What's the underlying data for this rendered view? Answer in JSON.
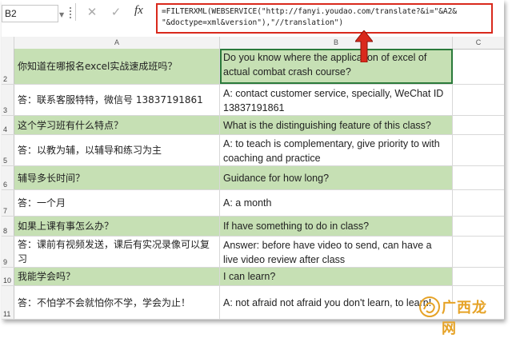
{
  "name_box": "B2",
  "formula_bar": {
    "cancel_icon": "cross-icon",
    "enter_icon": "check-icon",
    "function_label": "fx",
    "formula_line1": "=FILTERXML(WEBSERVICE(\"http://fanyi.youdao.com/translate?&i=\"&A2&",
    "formula_line2": "\"&doctype=xml&version\"),\"//translation\")"
  },
  "columns": [
    "A",
    "B",
    "C"
  ],
  "rows": [
    {
      "num": "2",
      "a": "你知道在哪报名excel实战速成班吗？",
      "b": "Do you know where the application of excel of actual combat crash course?",
      "green": true
    },
    {
      "num": "3",
      "a": "答：联系客服特特，微信号 13837191861",
      "b": "A: contact customer service, specially, WeChat ID 13837191861",
      "green": false
    },
    {
      "num": "4",
      "a": "这个学习班有什么特点？",
      "b": "What is the distinguishing feature of this class?",
      "green": true
    },
    {
      "num": "5",
      "a": "答：以教为辅，以辅导和练习为主",
      "b": "A: to teach is complementary, give priority to with coaching and practice",
      "green": false
    },
    {
      "num": "6",
      "a": "辅导多长时间？",
      "b": "Guidance for how long?",
      "green": true
    },
    {
      "num": "7",
      "a": "答：一个月",
      "b": "A: a month",
      "green": false
    },
    {
      "num": "8",
      "a": "如果上课有事怎么办？",
      "b": "If have something to do in class?",
      "green": true
    },
    {
      "num": "9",
      "a": "答：课前有视频发送，课后有实况录像可以复习",
      "b": "Answer: before have video to send, can have a live video review after class",
      "green": false
    },
    {
      "num": "10",
      "a": "我能学会吗？",
      "b": "I can learn?",
      "green": true
    },
    {
      "num": "11",
      "a": "答：不怕学不会就怕你不学，学会为止！",
      "b": "A: not afraid not afraid you don't learn, to learn!",
      "green": false
    }
  ],
  "watermark": {
    "text": "广西龙网",
    "logo_icon": "dragon-logo-icon"
  },
  "accent_color": "#d9291c",
  "green_fill": "#c6e0b4"
}
